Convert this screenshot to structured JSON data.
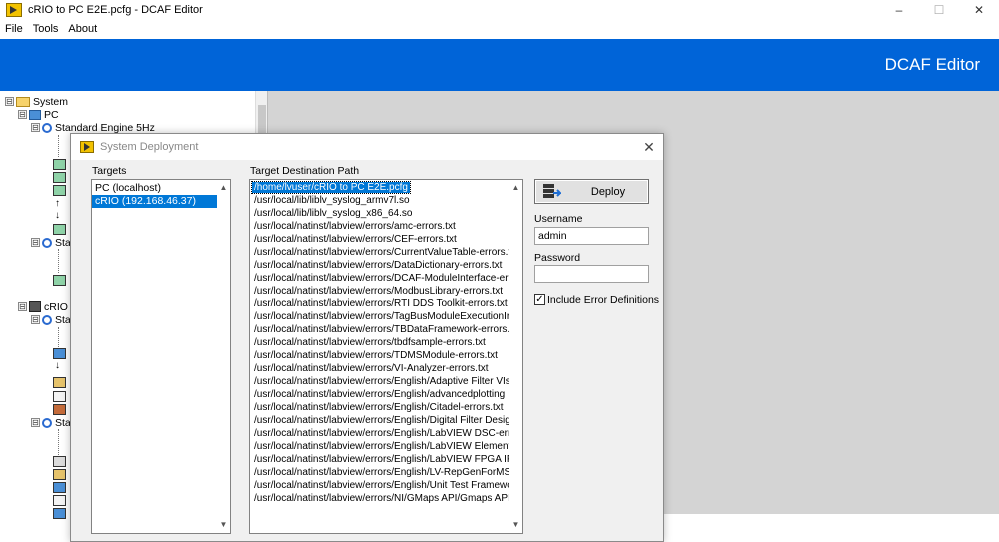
{
  "window": {
    "title": "cRIO to PC E2E.pcfg - DCAF Editor",
    "controls": [
      "–",
      "☐",
      "✕"
    ]
  },
  "menu": [
    "File",
    "Tools",
    "About"
  ],
  "header": {
    "title": "DCAF Editor",
    "color": "#0064d8"
  },
  "tree": {
    "system_label": "System",
    "pc_label": "PC",
    "engine1_label": "Standard Engine 5Hz",
    "engine2_label": "Sta",
    "crio_label": "cRIO",
    "engine3_label": "Star",
    "engine4_label": "Star",
    "expanders": [
      "⊟",
      "⊟",
      "⊟",
      "⊟",
      "⊟",
      "⊟",
      "⊟"
    ]
  },
  "dialog": {
    "title": "System Deployment",
    "close": "✕",
    "targets_label": "Targets",
    "targets": [
      {
        "label": "PC (localhost)",
        "selected": false
      },
      {
        "label": "cRIO (192.168.46.37)",
        "selected": true
      }
    ],
    "path_label": "Target Destination Path",
    "paths": [
      "/home/lvuser/cRIO to PC E2E.pcfg",
      "/usr/local/lib/liblv_syslog_armv7l.so",
      "/usr/local/lib/liblv_syslog_x86_64.so",
      "/usr/local/natinst/labview/errors/amc-errors.txt",
      "/usr/local/natinst/labview/errors/CEF-errors.txt",
      "/usr/local/natinst/labview/errors/CurrentValueTable-errors.t",
      "/usr/local/natinst/labview/errors/DataDictionary-errors.txt",
      "/usr/local/natinst/labview/errors/DCAF-ModuleInterface-err",
      "/usr/local/natinst/labview/errors/ModbusLibrary-errors.txt",
      "/usr/local/natinst/labview/errors/RTI DDS Toolkit-errors.txt",
      "/usr/local/natinst/labview/errors/TagBusModuleExecutionIr",
      "/usr/local/natinst/labview/errors/TBDataFramework-errors.t",
      "/usr/local/natinst/labview/errors/tbdfsample-errors.txt",
      "/usr/local/natinst/labview/errors/TDMSModule-errors.txt",
      "/usr/local/natinst/labview/errors/VI-Analyzer-errors.txt",
      "/usr/local/natinst/labview/errors/English/Adaptive Filter VIs-",
      "/usr/local/natinst/labview/errors/English/advancedplotting",
      "/usr/local/natinst/labview/errors/English/Citadel-errors.txt",
      "/usr/local/natinst/labview/errors/English/Digital Filter Desig",
      "/usr/local/natinst/labview/errors/English/LabVIEW DSC-erro",
      "/usr/local/natinst/labview/errors/English/LabVIEW Elementa",
      "/usr/local/natinst/labview/errors/English/LabVIEW FPGA IP I",
      "/usr/local/natinst/labview/errors/English/LV-RepGenForMSO",
      "/usr/local/natinst/labview/errors/English/Unit Test Framewo",
      "/usr/local/natinst/labview/errors/NI/GMaps API/Gmaps API"
    ],
    "deploy_label": "Deploy",
    "username_label": "Username",
    "username_value": "admin",
    "password_label": "Password",
    "password_value": "",
    "include_errors_label": "Include Error Definitions",
    "include_errors_checked": "✓",
    "scroll_up": "▲",
    "scroll_down": "▼"
  }
}
